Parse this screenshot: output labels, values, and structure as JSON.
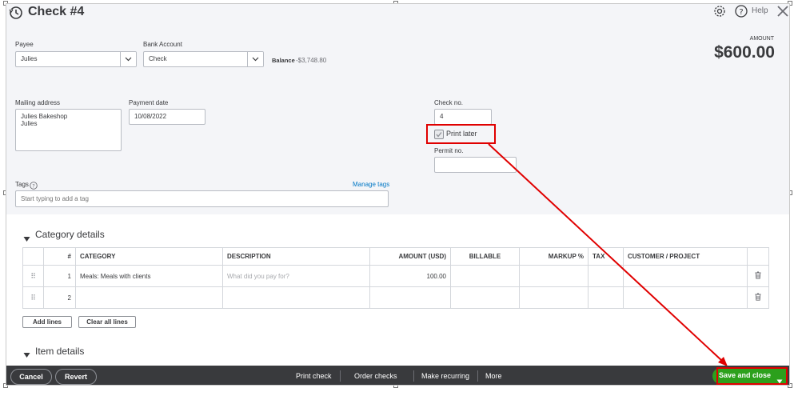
{
  "header": {
    "title": "Check #4",
    "help_label": "Help"
  },
  "amount": {
    "label": "AMOUNT",
    "value": "$600.00"
  },
  "payee": {
    "label": "Payee",
    "value": "Julies"
  },
  "bank_account": {
    "label": "Bank Account",
    "value": "Check",
    "balance_label": "Balance",
    "balance_value": "-$3,748.80"
  },
  "mailing_address": {
    "label": "Mailing address",
    "line1": "Julies Bakeshop",
    "line2": "Julies"
  },
  "payment_date": {
    "label": "Payment date",
    "value": "10/08/2022"
  },
  "check_no": {
    "label": "Check no.",
    "value": "4"
  },
  "print_later": {
    "label": "Print later",
    "checked": true
  },
  "permit_no": {
    "label": "Permit no.",
    "value": ""
  },
  "tags": {
    "label": "Tags",
    "placeholder": "Start typing to add a tag",
    "manage_label": "Manage tags"
  },
  "category_details": {
    "title": "Category details",
    "columns": [
      "#",
      "CATEGORY",
      "DESCRIPTION",
      "AMOUNT (USD)",
      "BILLABLE",
      "MARKUP %",
      "TAX",
      "CUSTOMER / PROJECT"
    ],
    "rows": [
      {
        "num": "1",
        "category": "Meals: Meals with clients",
        "description_placeholder": "What did you pay for?",
        "amount": "100.00"
      },
      {
        "num": "2",
        "category": "",
        "description_placeholder": "",
        "amount": ""
      }
    ],
    "add_lines_label": "Add lines",
    "clear_lines_label": "Clear all lines"
  },
  "item_details": {
    "title": "Item details"
  },
  "footer": {
    "cancel_label": "Cancel",
    "revert_label": "Revert",
    "print_check_label": "Print check",
    "order_checks_label": "Order checks",
    "make_recurring_label": "Make recurring",
    "more_label": "More",
    "save_close_label": "Save and close"
  },
  "colors": {
    "primary_green": "#2ca01c",
    "annotation_red": "#e00000",
    "link_blue": "#0077c5",
    "footer_dark": "#393a3d"
  }
}
